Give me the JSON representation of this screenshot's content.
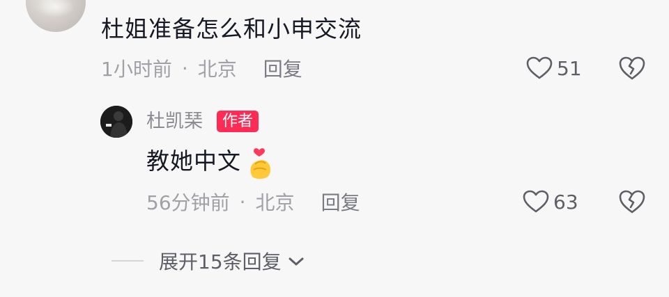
{
  "comment": {
    "text": "杜姐准备怎么和小申交流",
    "time": "1小时前",
    "separator": "·",
    "location": "北京",
    "reply_label": "回复",
    "likes": "51"
  },
  "reply": {
    "author": "杜凯琹",
    "badge": "作者",
    "text": "教她中文",
    "time": "56分钟前",
    "separator": "·",
    "location": "北京",
    "reply_label": "回复",
    "likes": "63"
  },
  "expand": {
    "label": "展开15条回复"
  },
  "icons": {
    "like": "heart-outline-icon",
    "dislike": "broken-heart-icon",
    "expand": "chevron-down-icon",
    "sticker": "finger-heart-sticker"
  },
  "colors": {
    "badge": "#fe2c55",
    "meta_text": "#a0a1a7",
    "body_text": "#161823"
  }
}
